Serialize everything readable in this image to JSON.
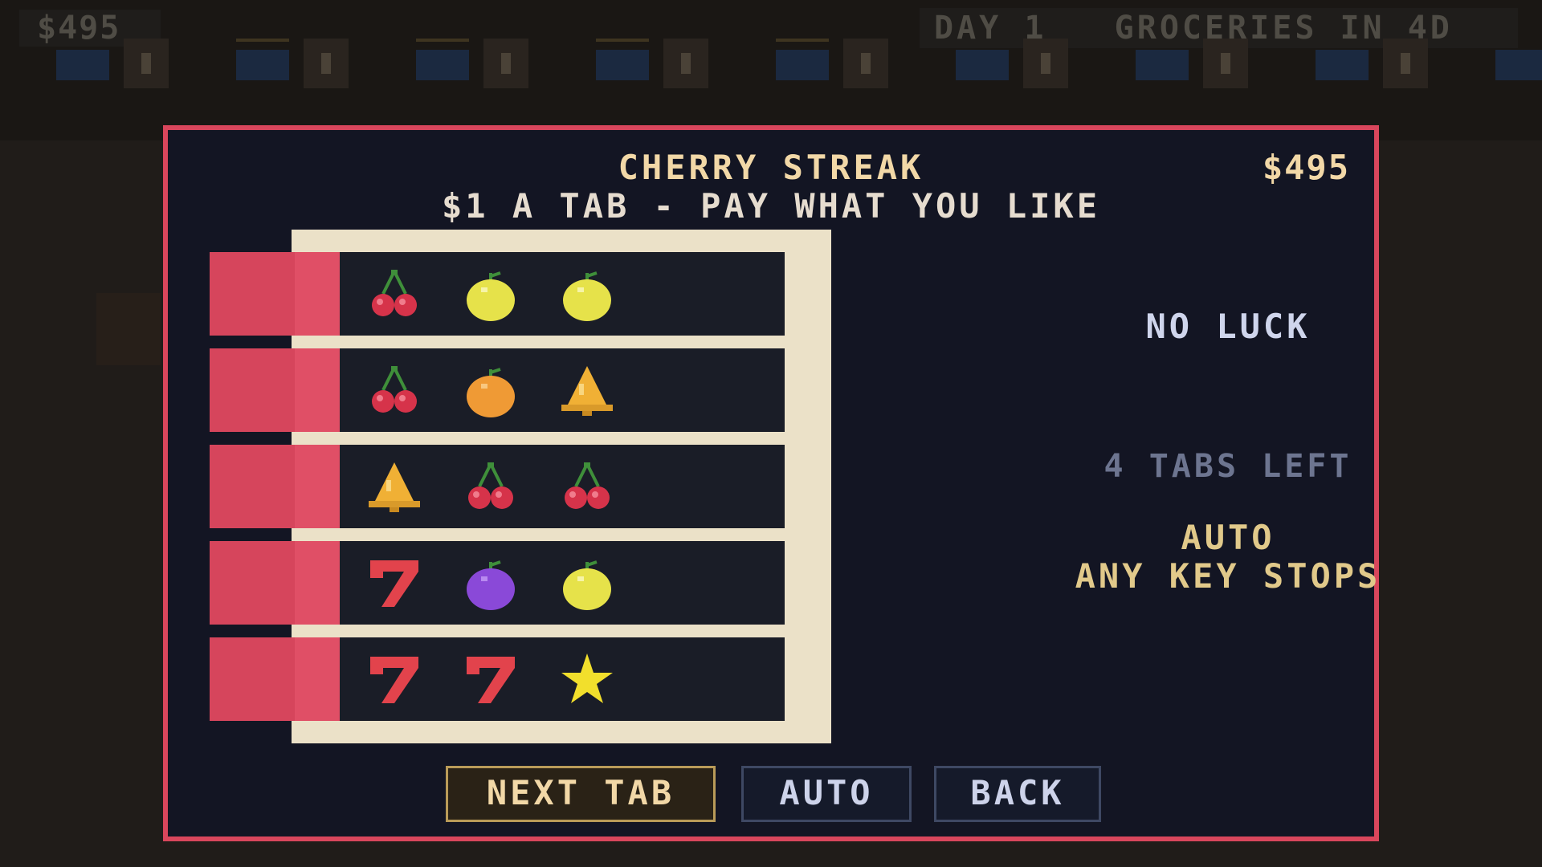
{
  "hud": {
    "money": "$495",
    "day_info": "DAY 1   GROCERIES IN 4D"
  },
  "dialog": {
    "title": "CHERRY STREAK",
    "money": "$495",
    "price_line": "$1 A TAB - PAY WHAT YOU LIKE",
    "result": "NO LUCK",
    "tabs_left": "4 TABS LEFT",
    "auto_line1": "AUTO",
    "auto_line2": "ANY KEY STOPS"
  },
  "tabs": [
    {
      "symbols": [
        "cherry",
        "lemon",
        "lemon"
      ]
    },
    {
      "symbols": [
        "cherry",
        "orange",
        "bell"
      ]
    },
    {
      "symbols": [
        "bell",
        "cherry",
        "cherry"
      ]
    },
    {
      "symbols": [
        "seven",
        "plum",
        "lemon"
      ]
    },
    {
      "symbols": [
        "seven",
        "seven",
        "star"
      ]
    }
  ],
  "buttons": {
    "next_tab": "NEXT TAB",
    "auto": "AUTO",
    "back": "BACK"
  },
  "colors": {
    "panel_border": "#d9465c",
    "panel_bg": "#131523",
    "title": "#f2d8a7",
    "accent": "#e1c98a"
  }
}
